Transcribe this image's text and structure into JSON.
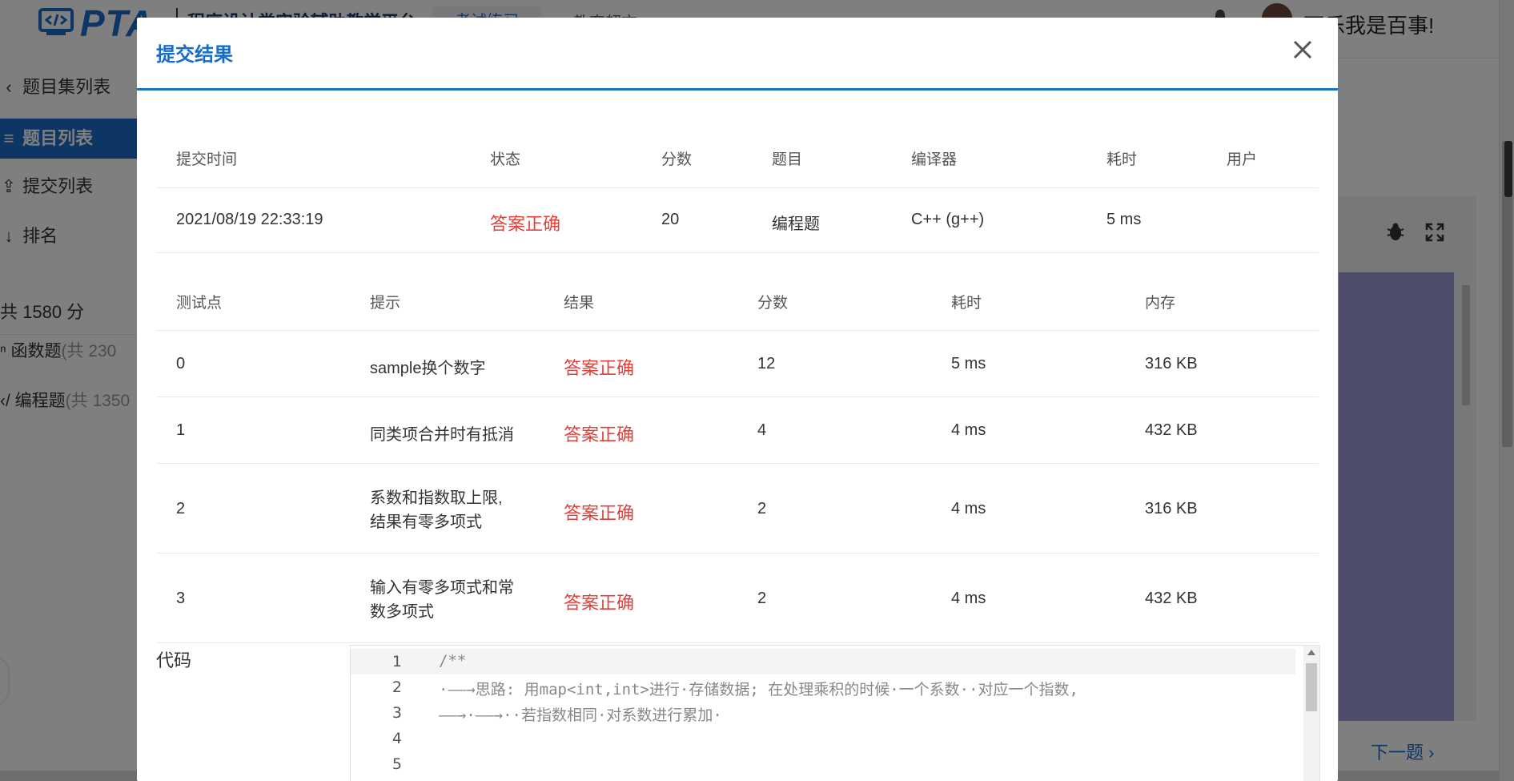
{
  "app": {
    "logo_text": "PTA",
    "platform_name": "程序设计类实验辅助教学平台",
    "nav_tabs": [
      "考试练习",
      "教育超市"
    ],
    "user_name": "可乐我是百事!"
  },
  "sidebar": {
    "items": [
      {
        "label": "题目集列表",
        "icon": "chevron-left-icon"
      },
      {
        "label": "题目列表",
        "icon": "list-icon",
        "active": true
      },
      {
        "label": "提交列表",
        "icon": "upload-icon"
      },
      {
        "label": "排名",
        "icon": "sort-numeric-icon"
      }
    ],
    "total_score": "共 1580 分",
    "types": [
      {
        "label": "函数题",
        "count": "(共 230",
        "icon": "function-icon"
      },
      {
        "label": "编程题",
        "count": "(共 1350",
        "icon": "code-icon"
      }
    ]
  },
  "right_panel": {
    "next_label": "下一题"
  },
  "modal": {
    "title": "提交结果",
    "summary_headers": [
      "提交时间",
      "状态",
      "分数",
      "题目",
      "编译器",
      "耗时",
      "用户"
    ],
    "summary_row": {
      "time": "2021/08/19 22:33:19",
      "status": "答案正确",
      "score": "20",
      "problem": "编程题",
      "compiler": "C++ (g++)",
      "duration": "5 ms",
      "user": ""
    },
    "test_headers": [
      "测试点",
      "提示",
      "结果",
      "分数",
      "耗时",
      "内存"
    ],
    "tests": [
      {
        "id": "0",
        "hint": "sample换个数字",
        "result": "答案正确",
        "score": "12",
        "time": "5 ms",
        "memory": "316 KB"
      },
      {
        "id": "1",
        "hint": "同类项合并时有抵消",
        "result": "答案正确",
        "score": "4",
        "time": "4 ms",
        "memory": "432 KB"
      },
      {
        "id": "2",
        "hint": "系数和指数取上限,\n结果有零多项式",
        "result": "答案正确",
        "score": "2",
        "time": "4 ms",
        "memory": "316 KB"
      },
      {
        "id": "3",
        "hint": "输入有零多项式和常\n数多项式",
        "result": "答案正确",
        "score": "2",
        "time": "4 ms",
        "memory": "432 KB"
      }
    ],
    "code_label": "代码",
    "code_lines": [
      {
        "n": "1",
        "text": "/**"
      },
      {
        "n": "2",
        "text": "·——→思路: 用map<int,int>进行·存储数据; 在处理乘积的时候·一个系数··对应一个指数,"
      },
      {
        "n": "3",
        "text": "——→·——→··若指数相同·对系数进行累加·"
      },
      {
        "n": "4",
        "text": ""
      },
      {
        "n": "5",
        "text": ""
      }
    ]
  }
}
